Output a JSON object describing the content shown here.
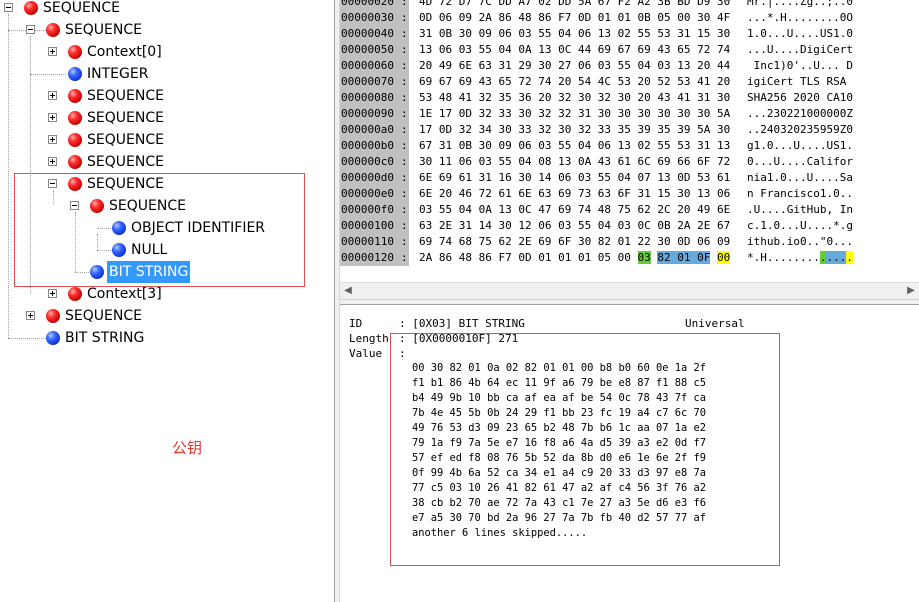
{
  "tree": {
    "nodes": [
      {
        "label": "SEQUENCE",
        "color": "red",
        "expander": "minus"
      },
      {
        "label": "SEQUENCE",
        "color": "red",
        "expander": "minus"
      },
      {
        "label": "Context[0]",
        "color": "red",
        "expander": "plus"
      },
      {
        "label": "INTEGER",
        "color": "blue",
        "expander": ""
      },
      {
        "label": "SEQUENCE",
        "color": "red",
        "expander": "plus"
      },
      {
        "label": "SEQUENCE",
        "color": "red",
        "expander": "plus"
      },
      {
        "label": "SEQUENCE",
        "color": "red",
        "expander": "plus"
      },
      {
        "label": "SEQUENCE",
        "color": "red",
        "expander": "plus"
      },
      {
        "label": "SEQUENCE",
        "color": "red",
        "expander": "minus"
      },
      {
        "label": "SEQUENCE",
        "color": "red",
        "expander": "minus"
      },
      {
        "label": "OBJECT IDENTIFIER",
        "color": "blue",
        "expander": ""
      },
      {
        "label": "NULL",
        "color": "blue",
        "expander": ""
      },
      {
        "label": "BIT STRING",
        "color": "blue",
        "expander": "",
        "selected": true
      },
      {
        "label": "Context[3]",
        "color": "red",
        "expander": "plus"
      },
      {
        "label": "SEQUENCE",
        "color": "red",
        "expander": "plus"
      },
      {
        "label": "BIT STRING",
        "color": "blue",
        "expander": ""
      }
    ],
    "annotation": "公钥"
  },
  "hex": {
    "rows": [
      {
        "addr": "00000020",
        "bytes": "4D 72 D7 7C DD A7 02 DD 5A 67 F2 A2 3B BD D9 30",
        "ascii": "Mr.|....Zg..;..0"
      },
      {
        "addr": "00000030",
        "bytes": "0D 06 09 2A 86 48 86 F7 0D 01 01 0B 05 00 30 4F",
        "ascii": "...*.H........0O"
      },
      {
        "addr": "00000040",
        "bytes": "31 0B 30 09 06 03 55 04 06 13 02 55 53 31 15 30",
        "ascii": "1.0...U....US1.0"
      },
      {
        "addr": "00000050",
        "bytes": "13 06 03 55 04 0A 13 0C 44 69 67 69 43 65 72 74",
        "ascii": "...U....DigiCert"
      },
      {
        "addr": "00000060",
        "bytes": "20 49 6E 63 31 29 30 27 06 03 55 04 03 13 20 44",
        "ascii": " Inc1)0'..U... D"
      },
      {
        "addr": "00000070",
        "bytes": "69 67 69 43 65 72 74 20 54 4C 53 20 52 53 41 20",
        "ascii": "igiCert TLS RSA "
      },
      {
        "addr": "00000080",
        "bytes": "53 48 41 32 35 36 20 32 30 32 30 20 43 41 31 30",
        "ascii": "SHA256 2020 CA10"
      },
      {
        "addr": "00000090",
        "bytes": "1E 17 0D 32 33 30 32 32 31 30 30 30 30 30 30 5A",
        "ascii": "...230221000000Z"
      },
      {
        "addr": "000000a0",
        "bytes": "17 0D 32 34 30 33 32 30 32 33 35 39 35 39 5A 30",
        "ascii": "..240320235959Z0"
      },
      {
        "addr": "000000b0",
        "bytes": "67 31 0B 30 09 06 03 55 04 06 13 02 55 53 31 13",
        "ascii": "g1.0...U....US1."
      },
      {
        "addr": "000000c0",
        "bytes": "30 11 06 03 55 04 08 13 0A 43 61 6C 69 66 6F 72",
        "ascii": "0...U....Califor"
      },
      {
        "addr": "000000d0",
        "bytes": "6E 69 61 31 16 30 14 06 03 55 04 07 13 0D 53 61",
        "ascii": "nia1.0...U....Sa"
      },
      {
        "addr": "000000e0",
        "bytes": "6E 20 46 72 61 6E 63 69 73 63 6F 31 15 30 13 06",
        "ascii": "n Francisco1.0.."
      },
      {
        "addr": "000000f0",
        "bytes": "03 55 04 0A 13 0C 47 69 74 48 75 62 2C 20 49 6E",
        "ascii": ".U....GitHub, In"
      },
      {
        "addr": "00000100",
        "bytes": "63 2E 31 14 30 12 06 03 55 04 03 0C 0B 2A 2E 67",
        "ascii": "c.1.0...U....*.g"
      },
      {
        "addr": "00000110",
        "bytes": "69 74 68 75 62 2E 69 6F 30 82 01 22 30 0D 06 09",
        "ascii": "ithub.io0..\"0..."
      },
      {
        "addr": "00000120",
        "bytes_plain": "2A 86 48 86 F7 0D 01 01 01 05 00 ",
        "hl_green": "03",
        "hl_blue": "82 01 0F",
        "hl_yellow": "00",
        "ascii_plain": "*.H........",
        "ascii_green": ".",
        "ascii_blue": "...",
        "ascii_yellow": "."
      }
    ]
  },
  "detail": {
    "id_label": "ID",
    "id_value": ": [0X03] BIT STRING",
    "class_value": "Universal",
    "length_label": "Length",
    "length_value": ": [0X0000010F] 271",
    "value_label": "Value",
    "value_colon": ":",
    "value_rows": [
      "00 30 82 01 0a 02 82 01 01 00 b8 b0 60 0e 1a 2f",
      "f1 b1 86 4b 64 ec 11 9f a6 79 be e8 87 f1 88 c5",
      "b4 49 9b 10 bb ca af ea af be 54 0c 78 43 7f ca",
      "7b 4e 45 5b 0b 24 29 f1 bb 23 fc 19 a4 c7 6c 70",
      "49 76 53 d3 09 23 65 b2 48 7b b6 1c aa 07 1a e2",
      "79 1a f9 7a 5e e7 16 f8 a6 4a d5 39 a3 e2 0d f7",
      "57 ef ed f8 08 76 5b 52 da 8b d0 e6 1e 6e 2f f9",
      "0f 99 4b 6a 52 ca 34 e1 a4 c9 20 33 d3 97 e8 7a",
      "77 c5 03 10 26 41 82 61 47 a2 af c4 56 3f 76 a2",
      "38 cb b2 70 ae 72 7a 43 c1 7e 27 a3 5e d6 e3 f6",
      "e7 a5 30 70 bd 2a 96 27 7a 7b fb 40 d2 57 77 af",
      "another 6 lines skipped....."
    ]
  }
}
